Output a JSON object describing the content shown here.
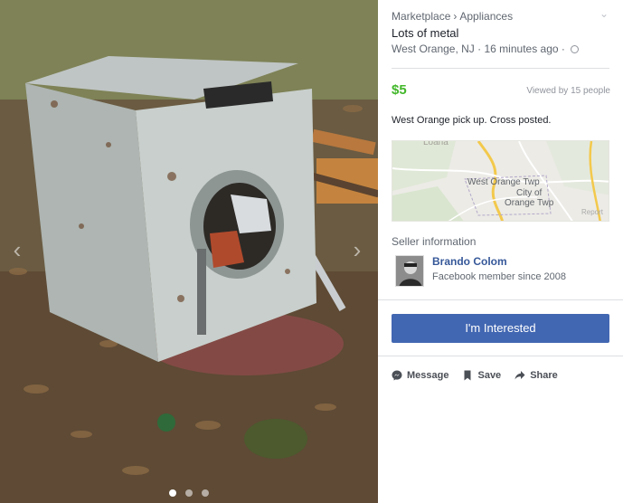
{
  "listing": {
    "breadcrumb": [
      "Marketplace",
      "Appliances"
    ],
    "breadcrumb_separator": "›",
    "title": "Lots of metal",
    "location": "West Orange, NJ",
    "posted": "16 minutes ago",
    "price": "$5",
    "viewed": "Viewed by 15 people",
    "description": "West Orange pick up. Cross posted."
  },
  "map": {
    "labels": [
      "Loana",
      "West Orange Twp",
      "City of",
      "Orange Twp"
    ],
    "report_label": "Report"
  },
  "seller": {
    "heading": "Seller information",
    "name": "Brando Colom",
    "since": "Facebook member since 2008"
  },
  "actions": {
    "interested_label": "I'm Interested",
    "message_label": "Message",
    "save_label": "Save",
    "share_label": "Share"
  },
  "photo": {
    "count": 3,
    "active_index": 0,
    "prev_icon": "chevron-left-icon",
    "next_icon": "chevron-right-icon"
  },
  "colors": {
    "price": "#42b72a",
    "button": "#4267b2",
    "link": "#365899"
  }
}
